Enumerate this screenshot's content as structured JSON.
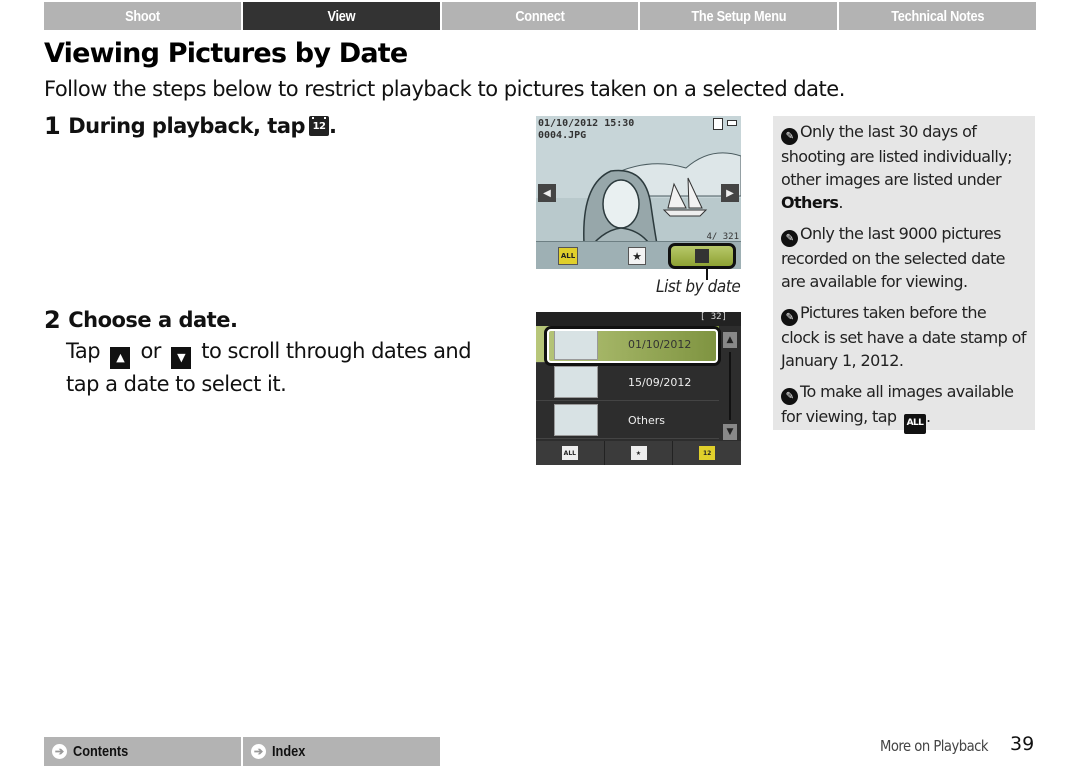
{
  "nav": {
    "tabs": [
      {
        "label": "Shoot",
        "active": false
      },
      {
        "label": "View",
        "active": true
      },
      {
        "label": "Connect",
        "active": false
      },
      {
        "label": "The Setup Menu",
        "active": false
      },
      {
        "label": "Technical Notes",
        "active": false
      }
    ]
  },
  "page": {
    "title": "Viewing Pictures by Date",
    "intro": "Follow the steps below to restrict playback to pictures taken on a selected date."
  },
  "steps": [
    {
      "number": "1",
      "heading": "During playback, tap",
      "icon": "list-by-date-icon",
      "heading_end": "."
    },
    {
      "number": "2",
      "heading": "Choose a date.",
      "body_pre": "Tap",
      "body_or": "or",
      "body_post": "to scroll through dates and tap a date to select it.",
      "up_icon": "▲",
      "down_icon": "▼"
    }
  ],
  "screen1": {
    "datetime": "01/10/2012 15:30",
    "filename": "0004.JPG",
    "counter": "4/ 321",
    "prev_arrow": "◀",
    "next_arrow": "▶",
    "all_label": "ALL",
    "fav_glyph": "★",
    "callout": "List by date"
  },
  "screen2": {
    "count": "[ 32]",
    "rows": [
      {
        "label": "01/10/2012",
        "selected": true
      },
      {
        "label": "15/09/2012",
        "selected": false
      },
      {
        "label": "Others",
        "selected": false
      }
    ],
    "up_arrow": "▲",
    "down_arrow": "▼",
    "bottom": [
      {
        "label": "ALL",
        "icon": "all-icon"
      },
      {
        "label": "★",
        "icon": "favorite-icon"
      },
      {
        "label": "12",
        "icon": "list-by-date-icon"
      }
    ]
  },
  "notes": [
    {
      "text": "Only the last 30 days of shooting are listed individually; other images are listed under",
      "bold": "Others",
      "end": "."
    },
    {
      "text": "Only the last 9000 pictures recorded on the selected date are available for viewing."
    },
    {
      "text": "Pictures taken before the clock is set have a date stamp of January 1, 2012."
    },
    {
      "text": "To make all images available for viewing, tap",
      "icon_label": "ALL",
      "end": "."
    }
  ],
  "footer": {
    "contents": "Contents",
    "index": "Index",
    "section": "More on Playback",
    "page_number": "39"
  }
}
